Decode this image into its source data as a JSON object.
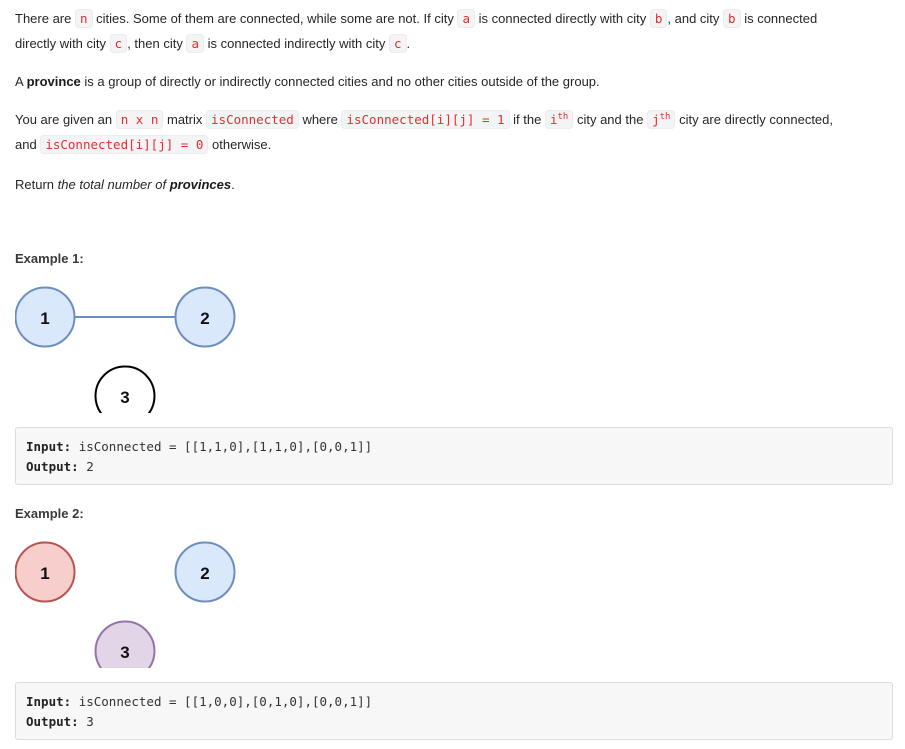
{
  "intro": {
    "p1_part1": "There are",
    "var_n": "n",
    "p1_part2": "cities. Some of them are connected, while some are not. If city",
    "var_a": "a",
    "p1_part3": "is connected directly with city",
    "var_b": "b",
    "p1_part4": ", and city",
    "p1_part5": "is connected",
    "p1_part6": "directly with city",
    "var_c": "c",
    "p1_part7": ", then city",
    "p1_part8": "is connected indirectly with city",
    "p1_part9": ".",
    "p2_part1": "A",
    "p2_bold": "province",
    "p2_part2": "is a group of directly or indirectly connected cities and no other cities outside of the group.",
    "p3_part1": "You are given an",
    "code_nxn": "n x n",
    "p3_part2": "matrix",
    "code_isConnected": "isConnected",
    "p3_part3": "where",
    "code_eq1": "isConnected[i][j] = 1",
    "p3_part4": "if the",
    "code_i": "i",
    "sup_th": "th",
    "p3_part5": "city and the",
    "code_j": "j",
    "p3_part6": "city are directly connected,",
    "p3_part7": "and",
    "code_eq0": "isConnected[i][j] = 0",
    "p3_part8": "otherwise.",
    "p4_part1": "Return",
    "p4_italic": "the total number of",
    "p4_bold": "provinces",
    "p4_part2": "."
  },
  "examples": [
    {
      "title": "Example 1:",
      "input_label": "Input:",
      "input_value": "isConnected = [[1,1,0],[1,1,0],[0,0,1]]",
      "output_label": "Output:",
      "output_value": "2",
      "nodes": [
        {
          "label": "1",
          "fill": "#dae8fc",
          "stroke": "#6c8ebf"
        },
        {
          "label": "2",
          "fill": "#dae8fc",
          "stroke": "#6c8ebf"
        },
        {
          "label": "3",
          "fill": "#ffffff",
          "stroke": "#000000"
        }
      ],
      "edge_color": "#6c8ebf"
    },
    {
      "title": "Example 2:",
      "input_label": "Input:",
      "input_value": "isConnected = [[1,0,0],[0,1,0],[0,0,1]]",
      "output_label": "Output:",
      "output_value": "3",
      "nodes": [
        {
          "label": "1",
          "fill": "#f8cecc",
          "stroke": "#b85450"
        },
        {
          "label": "2",
          "fill": "#dae8fc",
          "stroke": "#6c8ebf"
        },
        {
          "label": "3",
          "fill": "#e1d5e7",
          "stroke": "#9673a6"
        }
      ]
    }
  ]
}
